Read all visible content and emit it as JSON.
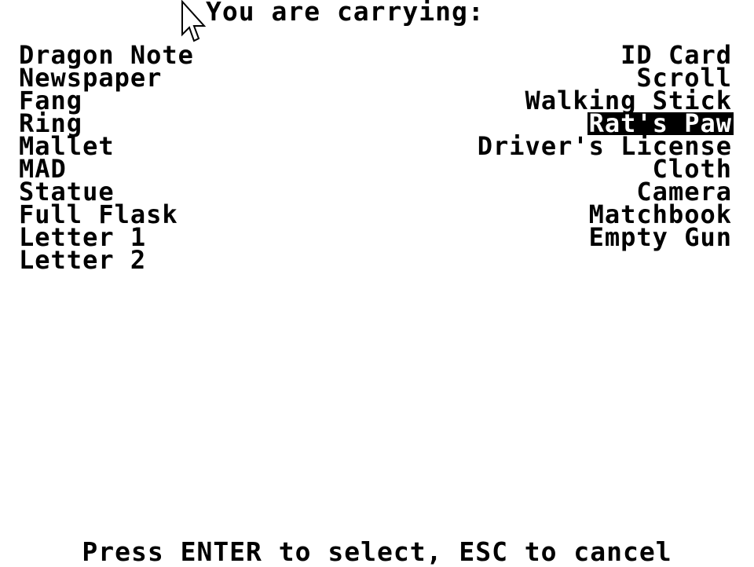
{
  "header": {
    "title": "You are carrying:"
  },
  "inventory": {
    "left": [
      "Dragon Note",
      "Newspaper",
      "Fang",
      "Ring",
      "Mallet",
      "MAD",
      "Statue",
      "Full Flask",
      "Letter 1",
      "Letter 2"
    ],
    "right": [
      "ID Card",
      "Scroll",
      "Walking Stick",
      "Rat's Paw",
      "Driver's License",
      "Cloth",
      "Camera",
      "Matchbook",
      "Empty Gun"
    ],
    "selected": "Rat's Paw"
  },
  "footer": {
    "hint": "Press ENTER to select, ESC to cancel"
  },
  "icons": {
    "cursor": "mouse-pointer-icon"
  }
}
